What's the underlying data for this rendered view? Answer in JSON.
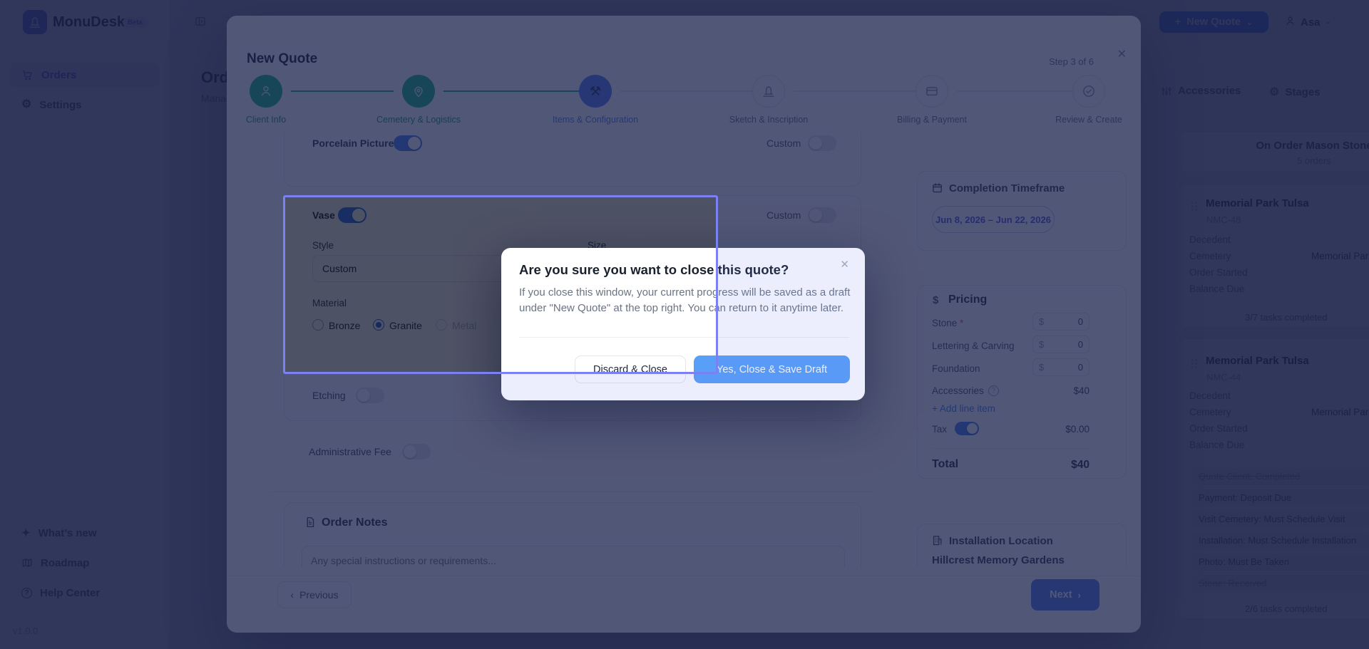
{
  "colors": {
    "primary_blue": "#4b7bf5",
    "confirm_blue": "#579ff7",
    "success_green": "#10b981",
    "active_step_blue": "#4f7cf6",
    "highlight_border": "#7b80f3",
    "link_blue": "#3b82f6",
    "date_chip_indigo": "#4a54e1",
    "required_red": "#ef4444"
  },
  "app": {
    "brand": {
      "name": "MonuDesk",
      "badge": "Beta"
    },
    "sidebar": {
      "items": [
        {
          "label": "Orders"
        },
        {
          "label": "Settings"
        }
      ],
      "footer_items": [
        {
          "label": "What’s new"
        },
        {
          "label": "Roadmap"
        },
        {
          "label": "Help Center"
        }
      ],
      "version": "v1.0.0"
    },
    "header": {
      "new_quote": "New Quote",
      "user": "Asa"
    },
    "page": {
      "title": "Orders",
      "subtitle": "Manage your orders"
    },
    "board": {
      "toolbar": {
        "accessories": "Accessories",
        "stages": "Stages"
      },
      "column": {
        "title": "On Order Mason Stone",
        "count": "5 orders"
      },
      "cards": [
        {
          "title": "Memorial Park Tulsa",
          "code": "NMC-48",
          "fields": [
            {
              "label": "Decedent",
              "value": ""
            },
            {
              "label": "Cemetery",
              "value": "Memorial Park Tulsa"
            },
            {
              "label": "Order Started",
              "value": ""
            },
            {
              "label": "Balance Due",
              "value": ""
            }
          ],
          "footer": "3/7 tasks completed"
        },
        {
          "title": "Memorial Park Tulsa",
          "code": "NMC-44",
          "fields": [
            {
              "label": "Decedent",
              "value": ""
            },
            {
              "label": "Cemetery",
              "value": "Memorial Park Tulsa"
            },
            {
              "label": "Order Started",
              "value": ""
            },
            {
              "label": "Balance Due",
              "value": ""
            }
          ],
          "tasks": [
            {
              "label": "Quote Client: Completed",
              "done": true
            },
            {
              "label": "Payment: Deposit Due",
              "done": false
            },
            {
              "label": "Visit Cemetery: Must Schedule Visit",
              "done": false
            },
            {
              "label": "Installation: Must Schedule Installation",
              "done": false
            },
            {
              "label": "Photo: Must Be Taken",
              "done": false
            },
            {
              "label": "Stone: Received",
              "done": true
            }
          ],
          "footer": "2/6 tasks completed"
        }
      ]
    }
  },
  "modal": {
    "title": "New Quote",
    "step_indicator": "Step 3 of 6",
    "steps": [
      {
        "label": "Client Info",
        "state": "complete"
      },
      {
        "label": "Cemetery & Logistics",
        "state": "complete"
      },
      {
        "label": "Items & Configuration",
        "state": "active"
      },
      {
        "label": "Sketch & Inscription",
        "state": "upcoming"
      },
      {
        "label": "Billing & Payment",
        "state": "upcoming"
      },
      {
        "label": "Review & Create",
        "state": "upcoming"
      }
    ],
    "form": {
      "porcelain": {
        "label": "Porcelain Picture",
        "custom_label": "Custom"
      },
      "vase": {
        "label": "Vase",
        "custom_label": "Custom",
        "style_label": "Style",
        "style_value": "Custom",
        "size_label": "Size",
        "material_label": "Material",
        "materials": [
          {
            "label": "Bronze",
            "state": "off"
          },
          {
            "label": "Granite",
            "state": "selected"
          },
          {
            "label": "Metal",
            "state": "disabled"
          }
        ]
      },
      "etching_label": "Etching",
      "admin_fee_label": "Administrative Fee",
      "notes": {
        "title": "Order Notes",
        "placeholder": "Any special instructions or requirements..."
      }
    },
    "summary": {
      "timeframe": {
        "title": "Completion Timeframe",
        "range": "Jun 8, 2026 – Jun 22, 2026"
      },
      "pricing": {
        "title": "Pricing",
        "currency": "$",
        "rows": [
          {
            "label": "Stone",
            "required": true,
            "value": "0"
          },
          {
            "label": "Lettering & Carving",
            "required": false,
            "value": "0"
          },
          {
            "label": "Foundation",
            "required": false,
            "value": "0"
          }
        ],
        "accessories_label": "Accessories",
        "accessories_value": "$40",
        "add_line_item": "Add line item",
        "tax_label": "Tax",
        "tax_value": "$0.00",
        "total_label": "Total",
        "total_value": "$40"
      },
      "location": {
        "title": "Installation Location",
        "value": "Hillcrest Memory Gardens"
      }
    },
    "footer": {
      "previous": "Previous",
      "next": "Next"
    }
  },
  "dialog": {
    "title": "Are you sure you want to close this quote?",
    "body": "If you close this window, your current progress will be saved as a draft under \"New Quote\" at the top right. You can return to it anytime later.",
    "discard": "Discard & Close",
    "confirm": "Yes, Close & Save Draft"
  }
}
